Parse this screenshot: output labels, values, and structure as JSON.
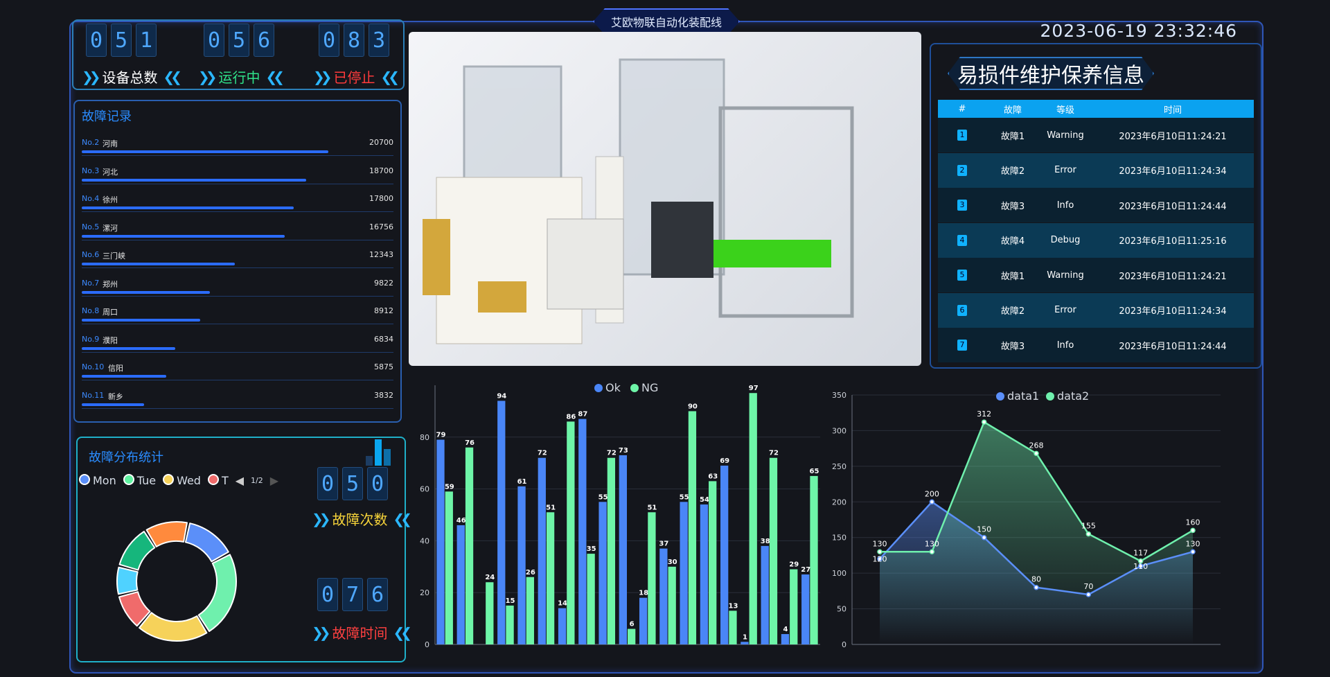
{
  "header": {
    "title": "艾欧物联自动化装配线",
    "datetime": "2023-06-19 23:32:46"
  },
  "stats": {
    "total": {
      "digits": [
        "0",
        "5",
        "1"
      ],
      "label": "设备总数"
    },
    "running": {
      "digits": [
        "0",
        "5",
        "6"
      ],
      "label": "运行中"
    },
    "stopped": {
      "digits": [
        "0",
        "8",
        "3"
      ],
      "label": "已停止"
    }
  },
  "fault_records": {
    "title": "故障记录",
    "items": [
      {
        "no": "No.2",
        "name": "河南",
        "value": "20700",
        "ratio": 0.79
      },
      {
        "no": "No.3",
        "name": "河北",
        "value": "18700",
        "ratio": 0.72
      },
      {
        "no": "No.4",
        "name": "徐州",
        "value": "17800",
        "ratio": 0.68
      },
      {
        "no": "No.5",
        "name": "漯河",
        "value": "16756",
        "ratio": 0.65
      },
      {
        "no": "No.6",
        "name": "三门峡",
        "value": "12343",
        "ratio": 0.49
      },
      {
        "no": "No.7",
        "name": "郑州",
        "value": "9822",
        "ratio": 0.41
      },
      {
        "no": "No.8",
        "name": "周口",
        "value": "8912",
        "ratio": 0.38
      },
      {
        "no": "No.9",
        "name": "濮阳",
        "value": "6834",
        "ratio": 0.3
      },
      {
        "no": "No.10",
        "name": "信阳",
        "value": "5875",
        "ratio": 0.27
      },
      {
        "no": "No.11",
        "name": "新乡",
        "value": "3832",
        "ratio": 0.2
      }
    ]
  },
  "distribution": {
    "title": "故障分布统计",
    "legend": [
      {
        "label": "Mon",
        "color": "#5b8ff9"
      },
      {
        "label": "Tue",
        "color": "#5ff2a0"
      },
      {
        "label": "Wed",
        "color": "#f6d25a"
      },
      {
        "label": "T",
        "color": "#f06b6b"
      }
    ],
    "pager": "1/2",
    "fault_count": {
      "digits": [
        "0",
        "5",
        "0"
      ],
      "label": "故障次数"
    },
    "fault_time": {
      "digits": [
        "0",
        "7",
        "6"
      ],
      "label": "故障时间"
    },
    "donut_colors": [
      "#5b8ff9",
      "#6ff0ad",
      "#f6d25a",
      "#f06b6b",
      "#4fd2ff",
      "#16b67c",
      "#ff8a3d"
    ],
    "donut_values": [
      14,
      24,
      20,
      10,
      8,
      12,
      12
    ]
  },
  "maintenance": {
    "title": "易损件维护保养信息",
    "columns": [
      "#",
      "故障",
      "等级",
      "时间"
    ],
    "rows": [
      {
        "idx": "1",
        "fault": "故障1",
        "level": "Warning",
        "time": "2023年6月10日11:24:21"
      },
      {
        "idx": "2",
        "fault": "故障2",
        "level": "Error",
        "time": "2023年6月10日11:24:34"
      },
      {
        "idx": "3",
        "fault": "故障3",
        "level": "Info",
        "time": "2023年6月10日11:24:44"
      },
      {
        "idx": "4",
        "fault": "故障4",
        "level": "Debug",
        "time": "2023年6月10日11:25:16"
      },
      {
        "idx": "5",
        "fault": "故障1",
        "level": "Warning",
        "time": "2023年6月10日11:24:21"
      },
      {
        "idx": "6",
        "fault": "故障2",
        "level": "Error",
        "time": "2023年6月10日11:24:34"
      },
      {
        "idx": "7",
        "fault": "故障3",
        "level": "Info",
        "time": "2023年6月10日11:24:44"
      }
    ]
  },
  "chart_data": [
    {
      "type": "bar",
      "ylim": [
        0,
        100
      ],
      "yticks": [
        0,
        20,
        40,
        60,
        80
      ],
      "legend_position": "top",
      "series": [
        {
          "name": "Ok",
          "color": "#4a86f7",
          "values": [
            79,
            94,
            72,
            87,
            55,
            73,
            18,
            37,
            54,
            69,
            1,
            38,
            4,
            27
          ]
        },
        {
          "name": "NG",
          "color": "#6ef5a8",
          "values": [
            59,
            76,
            24,
            15,
            61,
            26,
            51,
            14,
            86,
            35,
            72,
            6,
            51,
            30,
            55,
            90,
            63,
            13,
            97,
            72,
            29,
            65
          ]
        }
      ],
      "groups": [
        {
          "ok": 79,
          "ng": 59
        },
        {
          "ok": 46,
          "ng": 76
        },
        {
          "ok": null,
          "ng": 24
        },
        {
          "ok": 94,
          "ng": 15
        },
        {
          "ok": 61,
          "ng": 26
        },
        {
          "ok": 72,
          "ng": 51
        },
        {
          "ok": 14,
          "ng": 86
        },
        {
          "ok": 87,
          "ng": 35
        },
        {
          "ok": 55,
          "ng": 72
        },
        {
          "ok": 73,
          "ng": 6
        },
        {
          "ok": 18,
          "ng": 51
        },
        {
          "ok": 37,
          "ng": 30
        },
        {
          "ok": 55,
          "ng": 90
        },
        {
          "ok": 54,
          "ng": 63
        },
        {
          "ok": 69,
          "ng": 13
        },
        {
          "ok": 1,
          "ng": 97
        },
        {
          "ok": 38,
          "ng": 72
        },
        {
          "ok": 4,
          "ng": 29
        },
        {
          "ok": 27,
          "ng": 65
        }
      ]
    },
    {
      "type": "line",
      "ylim": [
        0,
        350
      ],
      "yticks": [
        0,
        50,
        100,
        150,
        200,
        250,
        300,
        350
      ],
      "legend_position": "top",
      "x": [
        "1",
        "2",
        "3",
        "4",
        "5",
        "6",
        "7"
      ],
      "series": [
        {
          "name": "data1",
          "color": "#5b8ff9",
          "values": [
            120,
            200,
            150,
            80,
            70,
            110,
            130
          ]
        },
        {
          "name": "data2",
          "color": "#6ff0ad",
          "values": [
            130,
            130,
            312,
            268,
            155,
            117,
            160
          ]
        }
      ]
    }
  ]
}
